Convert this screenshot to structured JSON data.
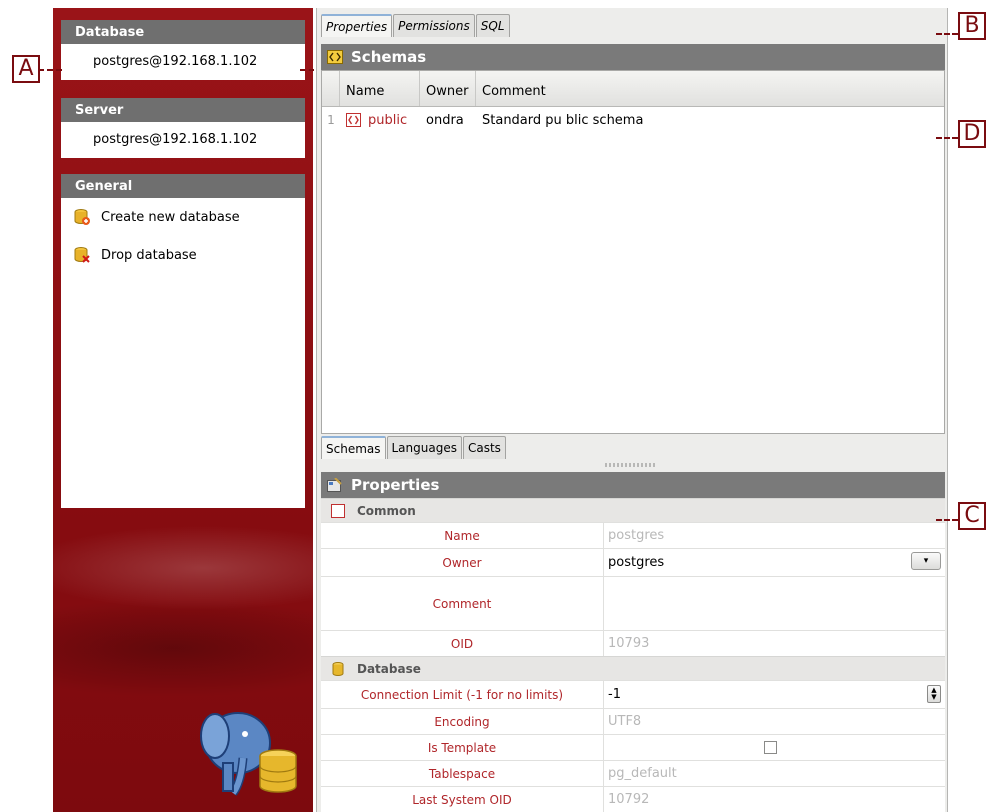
{
  "sidebar": {
    "database": {
      "header": "Database",
      "value": "postgres@192.168.1.102"
    },
    "server": {
      "header": "Server",
      "value": "postgres@192.168.1.102"
    },
    "general": {
      "header": "General",
      "items": [
        {
          "label": "Create new database",
          "icon": "database-add-icon"
        },
        {
          "label": "Drop database",
          "icon": "database-delete-icon"
        }
      ]
    }
  },
  "top_tabs": [
    "Properties",
    "Permissions",
    "SQL"
  ],
  "schemas": {
    "title": "Schemas",
    "columns": [
      "Name",
      "Owner",
      "Comment"
    ],
    "rows": [
      {
        "num": "1",
        "name": "public",
        "owner": "ondra",
        "comment": "Standard pu blic schema"
      }
    ]
  },
  "bottom_tabs": [
    "Schemas",
    "Languages",
    "Casts"
  ],
  "properties": {
    "title": "Properties",
    "groups": {
      "common": "Common",
      "database": "Database"
    },
    "name": {
      "label": "Name",
      "value": "postgres"
    },
    "owner": {
      "label": "Owner",
      "value": "postgres"
    },
    "comment": {
      "label": "Comment",
      "value": ""
    },
    "oid": {
      "label": "OID",
      "value": "10793"
    },
    "connection_limit": {
      "label": "Connection Limit (-1 for no limits)",
      "value": "-1"
    },
    "encoding": {
      "label": "Encoding",
      "value": "UTF8"
    },
    "is_template": {
      "label": "Is Template",
      "checked": false
    },
    "tablespace": {
      "label": "Tablespace",
      "value": "pg_default"
    },
    "last_system_oid": {
      "label": "Last System OID",
      "value": "10792"
    }
  },
  "callouts": [
    "A",
    "B",
    "C",
    "D"
  ],
  "colors": {
    "sidebar_red": "#8d0c10",
    "header_gray": "#7a7a7a",
    "label_red": "#b0262a",
    "callout": "#7a0c10"
  }
}
